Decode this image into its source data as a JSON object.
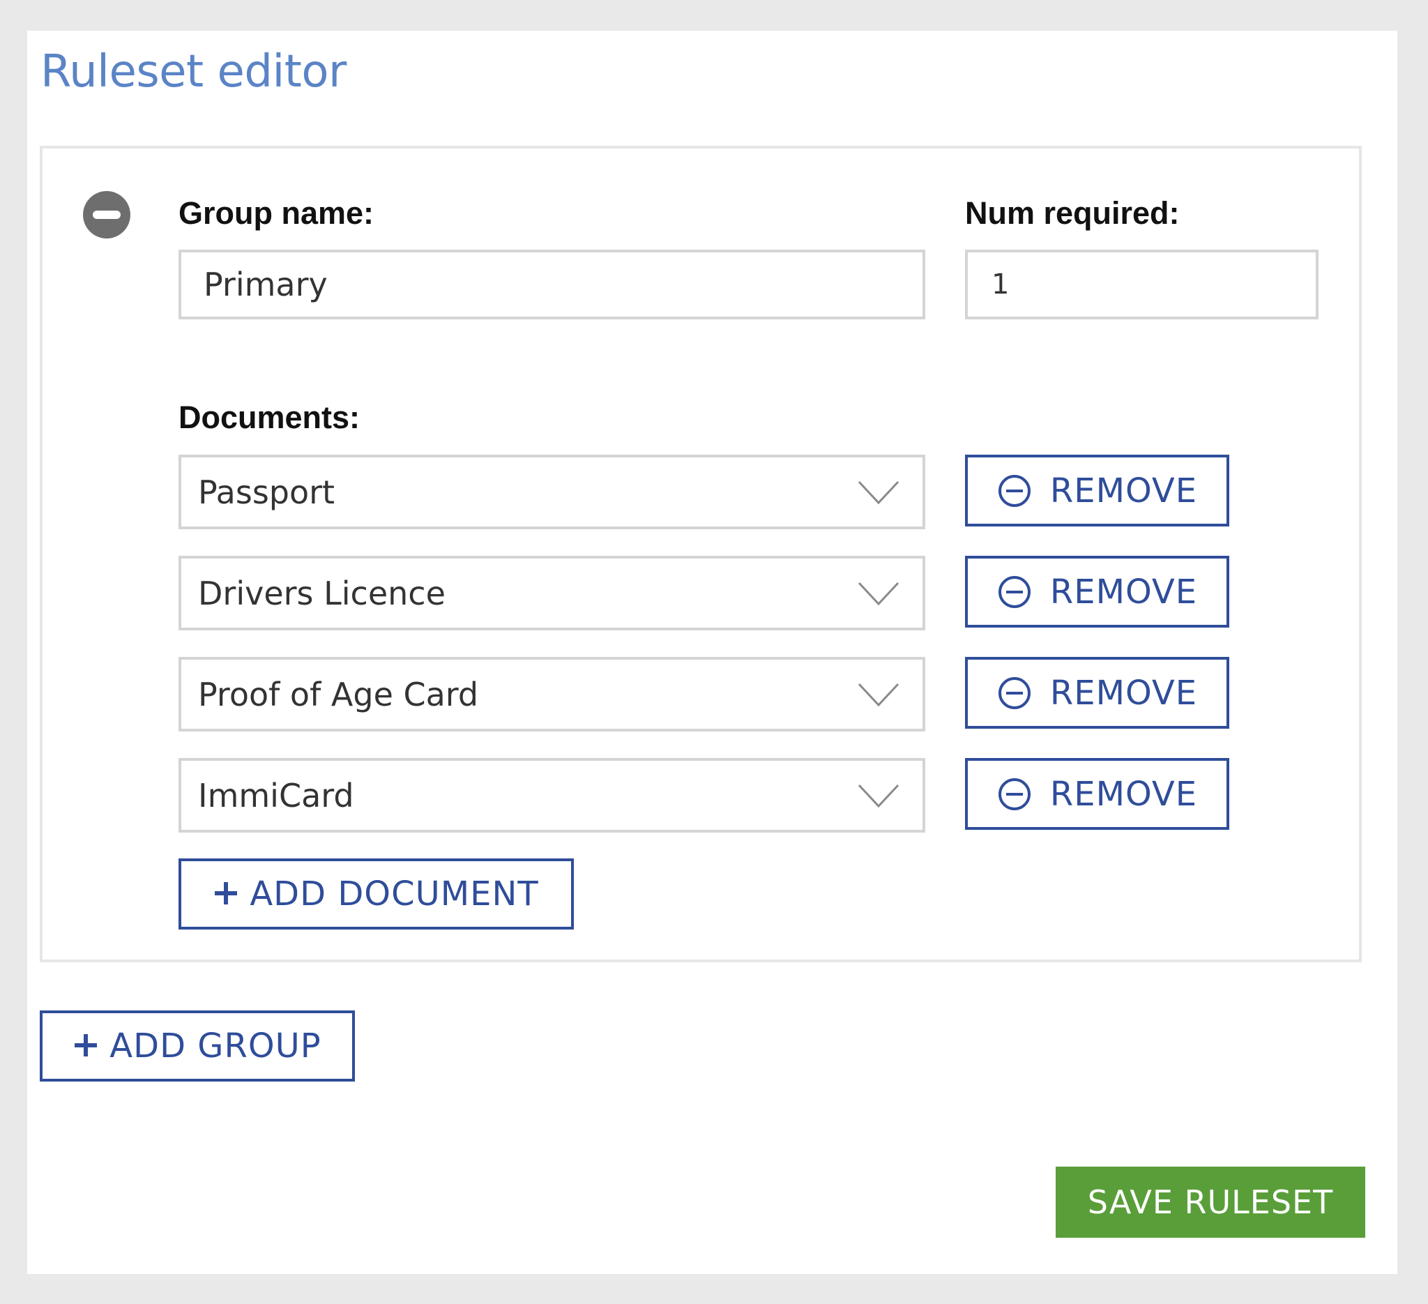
{
  "page": {
    "title": "Ruleset editor"
  },
  "group": {
    "group_name_label": "Group name:",
    "group_name_value": "Primary",
    "num_required_label": "Num required:",
    "num_required_value": "1",
    "documents_label": "Documents:",
    "documents": [
      {
        "value": "Passport",
        "remove_label": "REMOVE"
      },
      {
        "value": "Drivers Licence",
        "remove_label": "REMOVE"
      },
      {
        "value": "Proof of Age Card",
        "remove_label": "REMOVE"
      },
      {
        "value": "ImmiCard",
        "remove_label": "REMOVE"
      }
    ],
    "add_document_label": "ADD DOCUMENT"
  },
  "add_group_label": "ADD GROUP",
  "save_label": "SAVE RULESET",
  "icons": {
    "remove_group": "minus-circle-filled-icon",
    "remove_document": "minus-circle-outline-icon",
    "dropdown": "chevron-down-icon",
    "add": "plus-icon"
  },
  "colors": {
    "title": "#5b84c6",
    "accent_blue": "#2f4d9a",
    "save_green": "#5a9e3a",
    "icon_gray": "#6e6e6e",
    "background": "#e9e9e9"
  }
}
